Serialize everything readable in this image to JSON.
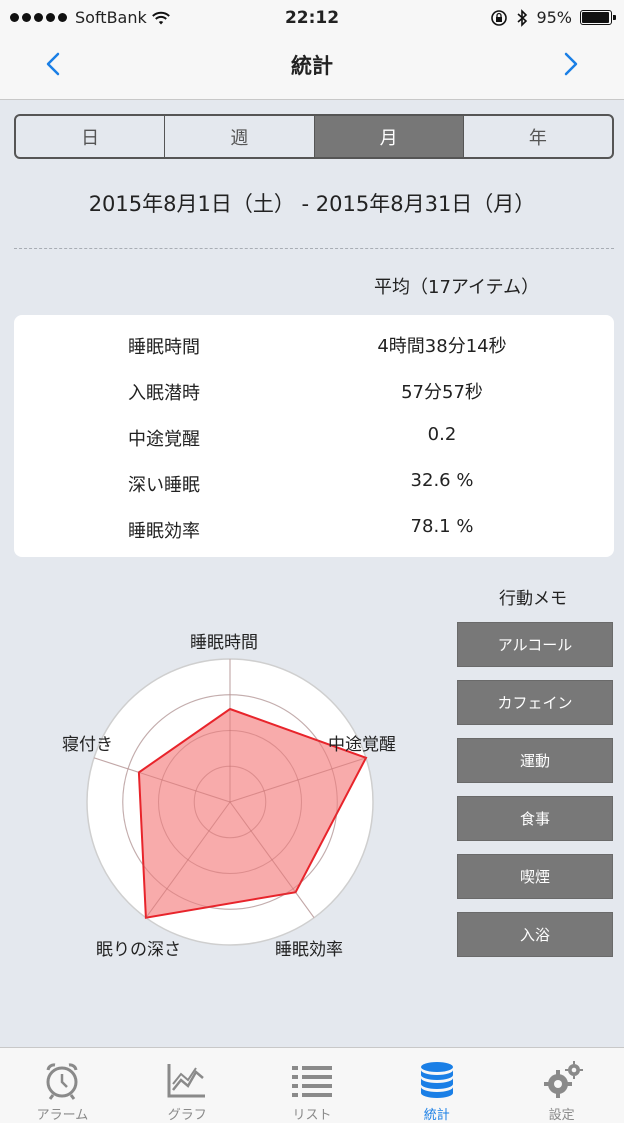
{
  "status_bar": {
    "carrier": "SoftBank",
    "time": "22:12",
    "battery": "95%",
    "battery_level": 0.95
  },
  "nav": {
    "title": "統計",
    "prev_icon": "chevron-left-icon",
    "next_icon": "chevron-right-icon",
    "accent": "#1a7fe6"
  },
  "segments": [
    {
      "label": "日"
    },
    {
      "label": "週"
    },
    {
      "label": "月"
    },
    {
      "label": "年"
    }
  ],
  "selected_segment": "月",
  "date_range": "2015年8月1日（土） - 2015年8月31日（月）",
  "average_label": "平均（17アイテム）",
  "stats": [
    {
      "label": "睡眠時間",
      "value": "4時間38分14秒"
    },
    {
      "label": "入眠潜時",
      "value": "57分57秒"
    },
    {
      "label": "中途覚醒",
      "value": "0.2"
    },
    {
      "label": "深い睡眠",
      "value": "32.6 %"
    },
    {
      "label": "睡眠効率",
      "value": "78.1 %"
    }
  ],
  "radar": {
    "labels": {
      "sleep_time": "睡眠時間",
      "awakening": "中途覚醒",
      "efficiency": "睡眠効率",
      "depth": "眠りの深さ",
      "onset": "寝付き"
    },
    "fill_color": "#f79c9c",
    "stroke_color": "#e8242b",
    "values": [
      0.65,
      1.0,
      0.78,
      1.0,
      0.67
    ]
  },
  "memo": {
    "title": "行動メモ",
    "buttons": [
      "アルコール",
      "カフェイン",
      "運動",
      "食事",
      "喫煙",
      "入浴"
    ]
  },
  "tabbar": [
    {
      "label": "アラーム",
      "icon": "alarm-clock-icon"
    },
    {
      "label": "グラフ",
      "icon": "line-chart-icon"
    },
    {
      "label": "リスト",
      "icon": "list-icon"
    },
    {
      "label": "統計",
      "icon": "database-icon"
    },
    {
      "label": "設定",
      "icon": "gears-icon"
    }
  ],
  "active_tab": "統計"
}
